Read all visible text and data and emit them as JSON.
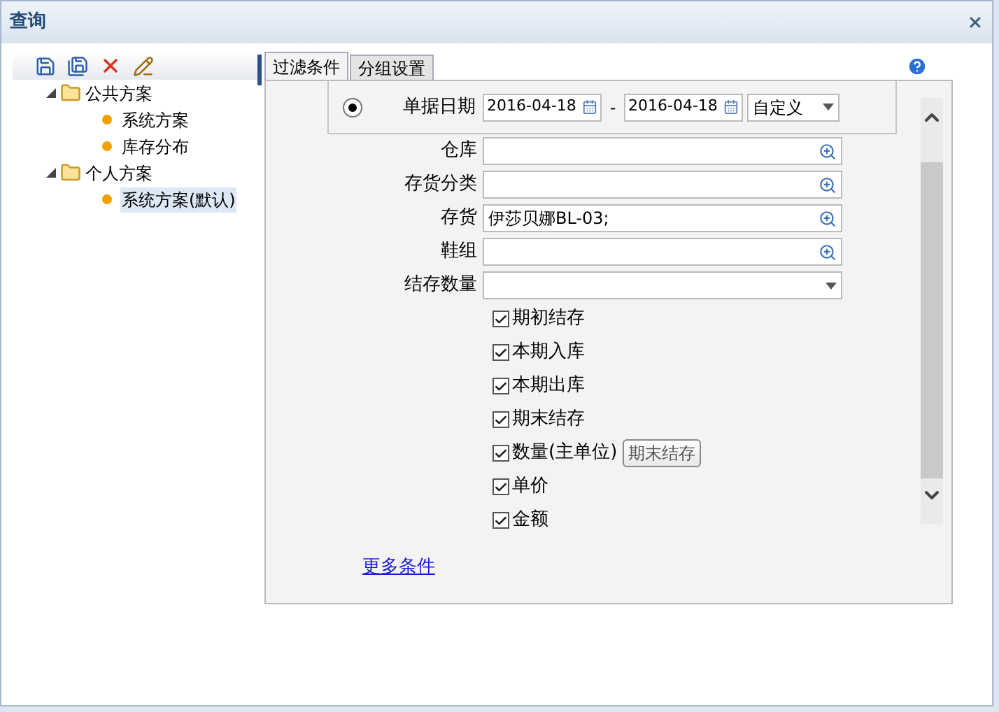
{
  "window": {
    "title": "查询"
  },
  "tree": [
    {
      "label": "公共方案",
      "expanded": true,
      "children": [
        {
          "label": "系统方案",
          "selected": false
        },
        {
          "label": "库存分布",
          "selected": false
        }
      ]
    },
    {
      "label": "个人方案",
      "expanded": true,
      "children": [
        {
          "label": "系统方案(默认)",
          "selected": true
        }
      ]
    }
  ],
  "tabs": [
    {
      "label": "过滤条件",
      "selected": true
    },
    {
      "label": "分组设置",
      "selected": false
    }
  ],
  "date_filter": {
    "selected": true,
    "label": "单据日期",
    "from": "2016-04-18",
    "separator": "-",
    "to": "2016-04-18",
    "period": "自定义"
  },
  "fields": [
    {
      "label": "仓库",
      "kind": "lookup"
    },
    {
      "label": "存货分类",
      "kind": "lookup"
    },
    {
      "label": "存货",
      "kind": "lookup",
      "value": "伊莎贝娜BL-03;"
    },
    {
      "label": "鞋组",
      "kind": "lookup"
    },
    {
      "label": "结存数量",
      "kind": "dropdown"
    }
  ],
  "checkboxes": [
    {
      "label": "期初结存",
      "checked": true
    },
    {
      "label": "本期入库",
      "checked": true
    },
    {
      "label": "本期出库",
      "checked": true
    },
    {
      "label": "期末结存",
      "checked": true
    },
    {
      "label": "数量(主单位)",
      "checked": true,
      "tooltip": "期末结存"
    },
    {
      "label": "单价",
      "checked": true
    },
    {
      "label": "金额",
      "checked": true
    }
  ],
  "more_link": "更多条件"
}
